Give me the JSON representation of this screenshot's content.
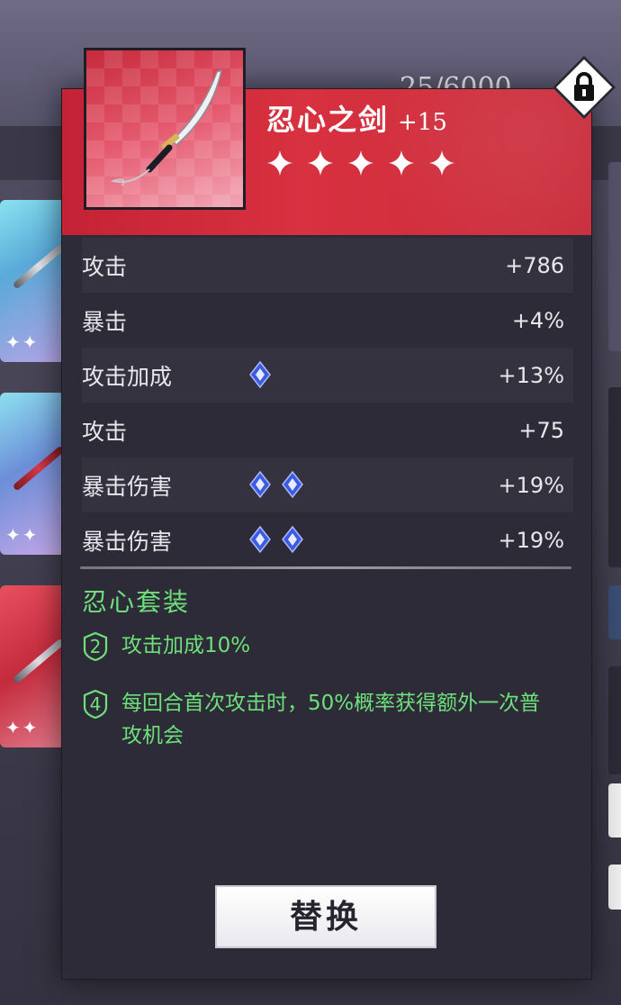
{
  "background": {
    "counter": "25/6000",
    "left_cards": [
      {
        "stars": "✦✦"
      },
      {
        "stars": "✦✦"
      },
      {
        "stars": "✦✦"
      }
    ]
  },
  "item": {
    "name": "忍心之剑",
    "level": "+15",
    "star_count": 5,
    "header_color": "#c42335",
    "icon": "katana-icon"
  },
  "stats": [
    {
      "label": "攻击",
      "gems": 0,
      "value": "+786"
    },
    {
      "label": "暴击",
      "gems": 0,
      "value": "+4%"
    },
    {
      "label": "攻击加成",
      "gems": 1,
      "value": "+13%"
    },
    {
      "label": "攻击",
      "gems": 0,
      "value": "+75"
    },
    {
      "label": "暴击伤害",
      "gems": 2,
      "value": "+19%"
    },
    {
      "label": "暴击伤害",
      "gems": 2,
      "value": "+19%"
    }
  ],
  "set_bonus": {
    "title": "忍心套装",
    "color": "#6de07a",
    "items": [
      {
        "pieces": "2",
        "text": "攻击加成10%"
      },
      {
        "pieces": "4",
        "text": "每回合首次攻击时，50%概率获得额外一次普攻机会"
      }
    ]
  },
  "buttons": {
    "replace": "替换",
    "lock_icon": "lock-icon"
  }
}
